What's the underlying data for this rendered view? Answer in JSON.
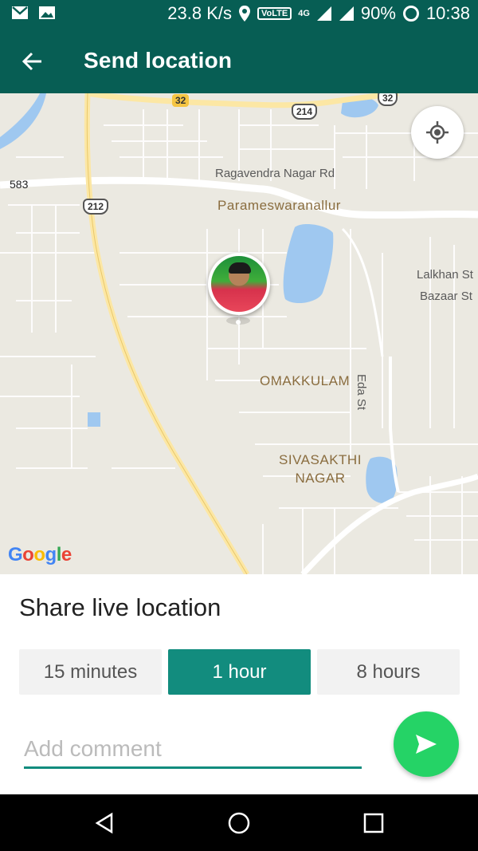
{
  "status_bar": {
    "speed": "23.8 K/s",
    "network": "4G",
    "volte": "VoLTE",
    "battery": "90%",
    "time": "10:38"
  },
  "toolbar": {
    "title": "Send location"
  },
  "map": {
    "labels": {
      "ragavendra": "Ragavendra Nagar Rd",
      "parameswaranallur": "Parameswaranallur",
      "lalkhan": "Lalkhan St",
      "bazaar": "Bazaar St",
      "omakkulam": "OMAKKULAM",
      "eda": "Eda St",
      "sivasakthi": "SIVASAKTHI NAGAR",
      "num_583": "583",
      "shield_32a": "32",
      "shield_214": "214",
      "shield_32b": "32",
      "shield_212": "212"
    },
    "google_logo": "Google"
  },
  "sheet": {
    "title": "Share live location",
    "options": [
      "15 minutes",
      "1 hour",
      "8 hours"
    ],
    "selected_option": "1 hour",
    "comment_placeholder": "Add comment"
  },
  "colors": {
    "primary_dark": "#075e54",
    "accent": "#128c7e",
    "send": "#25d366"
  },
  "icons": {
    "back": "arrow-left-icon",
    "locate": "my-location-icon",
    "send": "send-icon",
    "nav_back": "triangle-back-icon",
    "nav_home": "circle-home-icon",
    "nav_recents": "square-recents-icon"
  }
}
